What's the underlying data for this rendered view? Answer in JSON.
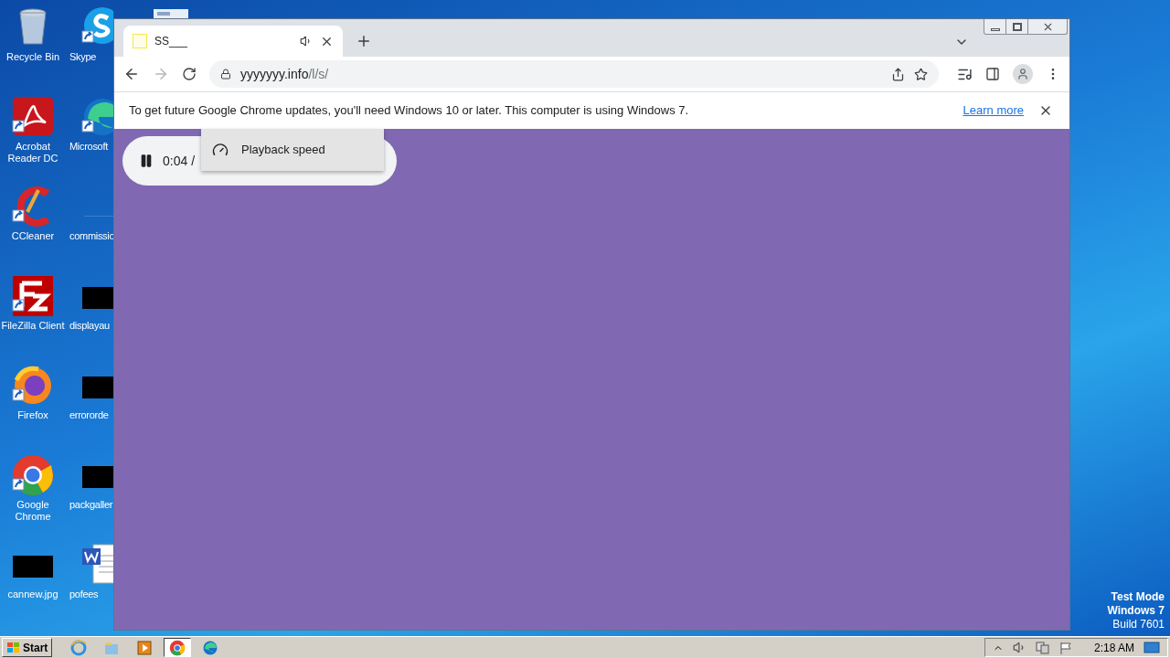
{
  "desktop": {
    "columns": [
      [
        {
          "label": "Recycle Bin",
          "kind": "recycle-bin",
          "shortcut": false
        },
        {
          "label": "Acrobat Reader DC",
          "kind": "acrobat",
          "shortcut": true
        },
        {
          "label": "CCleaner",
          "kind": "ccleaner",
          "shortcut": true
        },
        {
          "label": "FileZilla Client",
          "kind": "filezilla",
          "shortcut": true
        },
        {
          "label": "Firefox",
          "kind": "firefox",
          "shortcut": true
        },
        {
          "label": "Google Chrome",
          "kind": "chrome",
          "shortcut": true
        },
        {
          "label": "cannew.jpg",
          "kind": "thumbnail",
          "shortcut": false
        }
      ],
      [
        {
          "label": "Skype",
          "kind": "skype",
          "shortcut": true
        },
        {
          "label": "Microsoft",
          "kind": "edge",
          "shortcut": true
        },
        {
          "label": "commissio",
          "kind": "line",
          "shortcut": false
        },
        {
          "label": "displayau",
          "kind": "thumbnail",
          "shortcut": false
        },
        {
          "label": "errororde",
          "kind": "thumbnail",
          "shortcut": false
        },
        {
          "label": "packgaller",
          "kind": "thumbnail",
          "shortcut": false
        },
        {
          "label": "pofees",
          "kind": "word",
          "shortcut": false
        }
      ]
    ],
    "system_info": [
      "Test Mode",
      "Windows 7",
      "Build 7601"
    ]
  },
  "browser": {
    "tabs": [
      {
        "title": "SS___",
        "selected": true,
        "audio": true
      }
    ],
    "address": {
      "domain": "yyyyyyy.info",
      "path": "/l/s/"
    },
    "infobar": {
      "message": "To get future Google Chrome updates, you'll need Windows 10 or later. This computer is using Windows 7.",
      "link": "Learn more"
    },
    "media_player": {
      "time": "0:04 /",
      "playing": true
    },
    "menu": [
      {
        "label": "Playback speed"
      }
    ]
  },
  "taskbar": {
    "start": "Start",
    "apps": [
      {
        "kind": "ie",
        "active": false
      },
      {
        "kind": "explorer",
        "active": false
      },
      {
        "kind": "media",
        "active": false
      },
      {
        "kind": "chrome",
        "active": true
      },
      {
        "kind": "edge",
        "active": false
      }
    ],
    "clock": "2:18 AM"
  }
}
